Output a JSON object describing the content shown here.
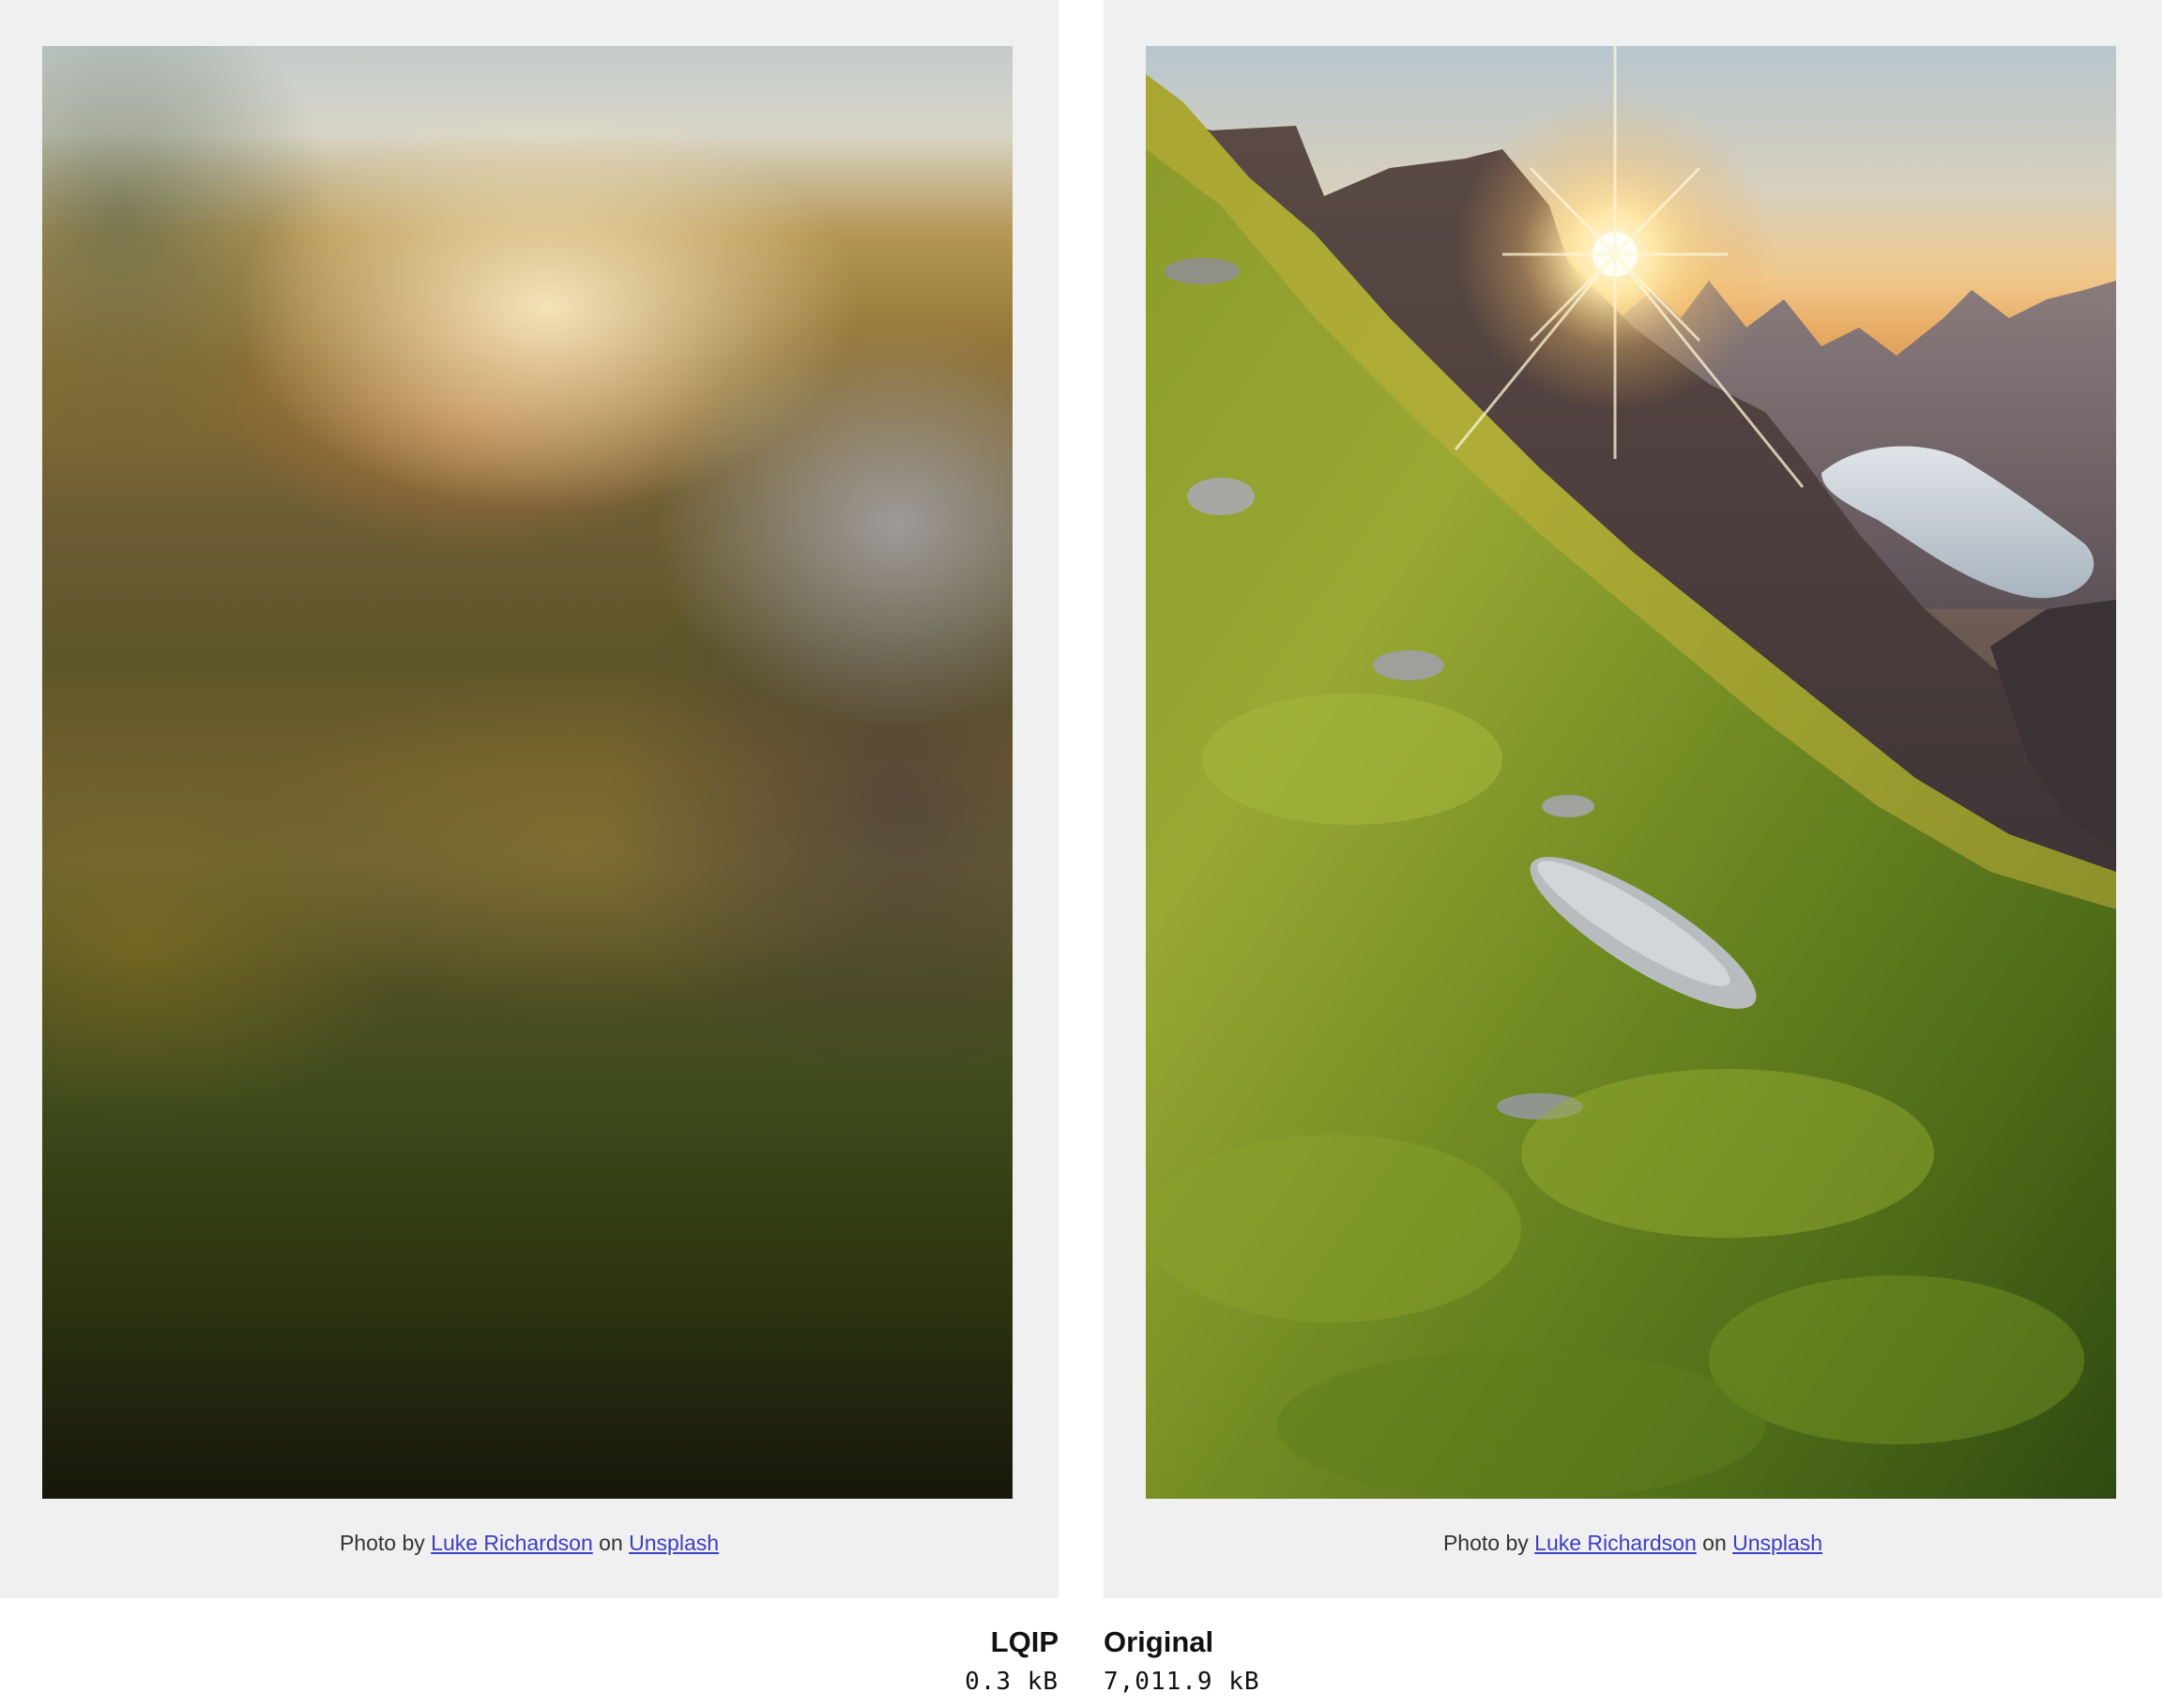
{
  "panels": {
    "left": {
      "caption": {
        "prefix": "Photo by",
        "author": "Luke Richardson",
        "middle": "on",
        "site": "Unsplash"
      }
    },
    "right": {
      "caption": {
        "prefix": "Photo by",
        "author": "Luke Richardson",
        "middle": "on",
        "site": "Unsplash"
      }
    }
  },
  "labels": {
    "left": {
      "title": "LQIP",
      "size": "0.3 kB"
    },
    "right": {
      "title": "Original",
      "size": "7,011.9 kB"
    }
  },
  "colors": {
    "panel_background": "#f0f0f0",
    "link": "#3b3fc4"
  }
}
